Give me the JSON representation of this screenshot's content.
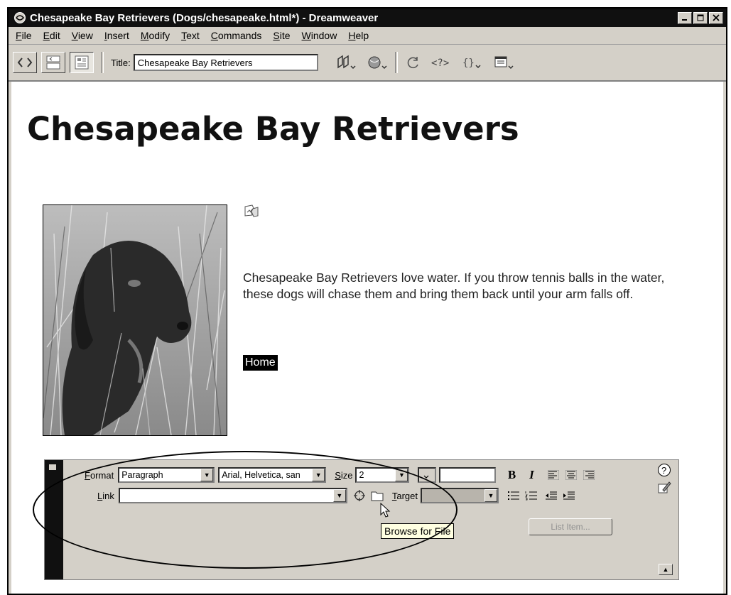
{
  "window": {
    "title": "Chesapeake Bay Retrievers (Dogs/chesapeake.html*) - Dreamweaver",
    "app_icon": "dreamweaver-icon",
    "controls": [
      "minimize-icon",
      "maximize-icon",
      "close-icon"
    ]
  },
  "menu": {
    "items": [
      {
        "mnemonic": "F",
        "rest": "ile"
      },
      {
        "mnemonic": "E",
        "rest": "dit"
      },
      {
        "mnemonic": "V",
        "rest": "iew"
      },
      {
        "mnemonic": "I",
        "rest": "nsert"
      },
      {
        "mnemonic": "M",
        "rest": "odify"
      },
      {
        "mnemonic": "T",
        "rest": "ext"
      },
      {
        "mnemonic": "C",
        "rest": "ommands"
      },
      {
        "mnemonic": "S",
        "rest": "ite"
      },
      {
        "mnemonic": "W",
        "rest": "indow"
      },
      {
        "mnemonic": "H",
        "rest": "elp"
      }
    ]
  },
  "toolbar": {
    "title_label": "Title:",
    "title_value": "Chesapeake Bay Retrievers",
    "view_buttons": [
      "code-view-icon",
      "split-view-icon",
      "design-view-icon"
    ],
    "tool_icons": [
      "file-management-icon",
      "preview-browser-icon",
      "refresh-icon",
      "reference-icon",
      "code-navigation-icon",
      "view-options-icon"
    ]
  },
  "document": {
    "heading": "Chesapeake Bay Retrievers",
    "photo": "dog-photo",
    "small_image": "broken-image-icon",
    "body_text": "Chesapeake Bay Retrievers love water. If you throw tennis balls in the water, these dogs will chase them and bring them back until your arm falls off.",
    "link_text": "Home"
  },
  "properties": {
    "format_label_mnemonic": "F",
    "format_label_rest": "ormat",
    "format_value": "Paragraph",
    "font_value": "Arial, Helvetica, san",
    "size_label_mnemonic": "S",
    "size_label_rest": "ize",
    "size_value": "2",
    "color_value": "",
    "bold": "B",
    "italic": "I",
    "link_label_mnemonic": "L",
    "link_label_rest": "ink",
    "link_value": "",
    "target_label_mnemonic": "T",
    "target_label_rest": "arget",
    "target_value": "",
    "list_item_button": "List Item...",
    "tooltip": "Browse for File"
  },
  "colors": {
    "title_bar": "#101010",
    "chrome": "#d4d0c8",
    "tooltip_bg": "#ffffe1"
  }
}
